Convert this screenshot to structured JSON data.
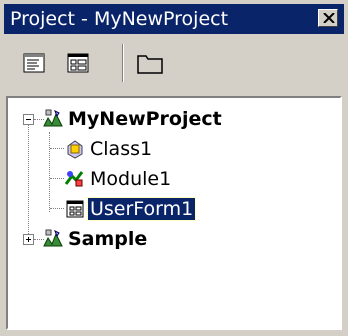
{
  "window": {
    "title": "Project - MyNewProject",
    "close_icon": "close-icon"
  },
  "toolbar": {
    "buttons": [
      {
        "name": "view-code-icon"
      },
      {
        "name": "view-object-icon"
      },
      {
        "name": "toggle-folders-icon"
      }
    ]
  },
  "tree": {
    "nodes": [
      {
        "label": "MyNewProject",
        "icon": "project-icon",
        "expanded": true,
        "bold": true
      },
      {
        "label": "Class1",
        "icon": "class-module-icon"
      },
      {
        "label": "Module1",
        "icon": "module-icon"
      },
      {
        "label": "UserForm1",
        "icon": "userform-icon",
        "selected": true
      },
      {
        "label": "Sample",
        "icon": "project-icon",
        "expanded": false,
        "bold": true
      }
    ]
  },
  "colors": {
    "titlebar": "#0a246a",
    "face": "#d4d0c8",
    "selection": "#0a246a"
  }
}
